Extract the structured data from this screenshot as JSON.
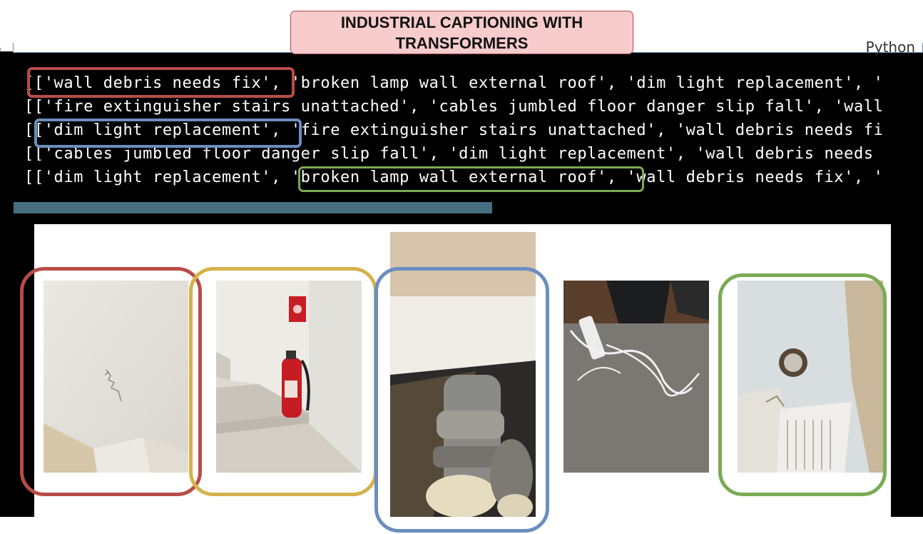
{
  "title": "INDUSTRIAL CAPTIONING WITH TRANSFORMERS",
  "cell": {
    "language_label": "Python"
  },
  "output": {
    "lines": [
      "[['wall debris needs fix', 'broken lamp wall external roof', 'dim light replacement', '",
      "[['fire extinguisher stairs unattached', 'cables jumbled floor danger slip fall', 'wall",
      "[['dim light replacement', 'fire extinguisher stairs unattached', 'wall debris needs fi",
      "[['cables jumbled floor danger slip fall', 'dim light replacement', 'wall debris needs",
      "[['dim light replacement', 'broken lamp wall external roof', 'wall debris needs fix', '"
    ],
    "highlights": [
      {
        "text": "['wall debris needs fix',",
        "color": "#b84c48"
      },
      {
        "text": "['dim light replacement',",
        "color": "#6b8ebf"
      },
      {
        "text": "'broken lamp wall external roof',",
        "color": "#7aab52"
      }
    ]
  },
  "photos": [
    {
      "name": "wall-crack-photo",
      "ring_color": "#b84c48"
    },
    {
      "name": "fire-extinguisher-stairs-photo",
      "ring_color": "#d4b24c"
    },
    {
      "name": "ceiling-lamp-photo",
      "ring_color": "#6b8ebf"
    },
    {
      "name": "cables-floor-photo",
      "ring_color": null
    },
    {
      "name": "roof-lamp-hole-photo",
      "ring_color": "#7aab52"
    }
  ],
  "colors": {
    "title_bg": "#f8cccc",
    "title_border": "#b24a4a",
    "terminal_bg": "#000000",
    "scrollbar": "#456f80"
  }
}
